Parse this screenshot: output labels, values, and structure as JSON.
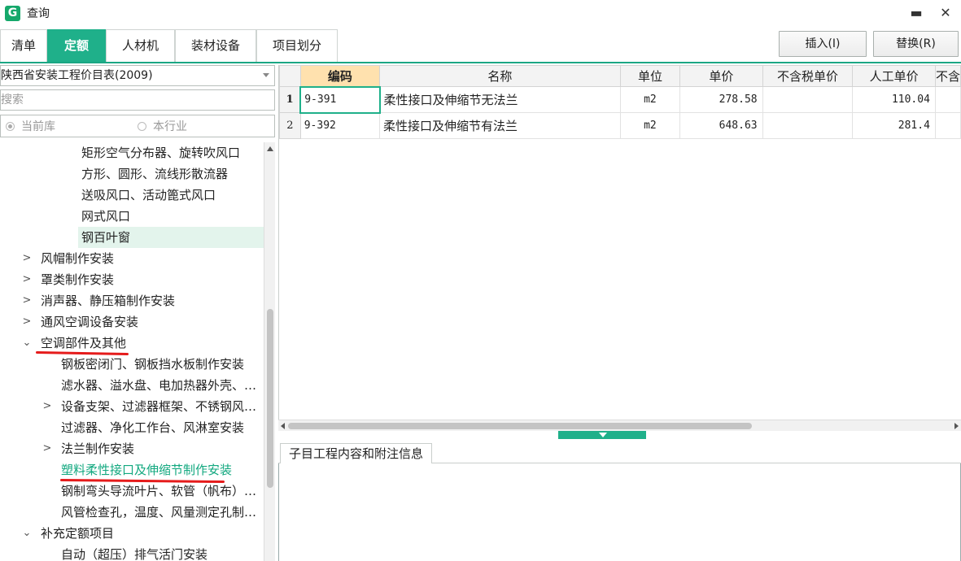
{
  "window": {
    "logo": "G",
    "title": "查询",
    "minimize_glyph": "▬",
    "close_glyph": "✕"
  },
  "tabs": [
    {
      "label": "清单",
      "active": false
    },
    {
      "label": "定额",
      "active": true
    },
    {
      "label": "人材机",
      "active": false
    },
    {
      "label": "装材设备",
      "active": false
    },
    {
      "label": "项目划分",
      "active": false
    }
  ],
  "actions": {
    "insert_label": "插入(I)",
    "replace_label": "替换(R)"
  },
  "library": {
    "selected": "陕西省安装工程价目表(2009)"
  },
  "search": {
    "placeholder": "搜索"
  },
  "scope": {
    "current_lib": "当前库",
    "this_industry": "本行业"
  },
  "tree": {
    "items": [
      {
        "label": "矩形空气分布器、旋转吹风口"
      },
      {
        "label": "方形、圆形、流线形散流器"
      },
      {
        "label": "送吸风口、活动篦式风口"
      },
      {
        "label": "网式风口"
      },
      {
        "label": "钢百叶窗"
      },
      {
        "label": "风帽制作安装"
      },
      {
        "label": "罩类制作安装"
      },
      {
        "label": "消声器、静压箱制作安装"
      },
      {
        "label": "通风空调设备安装"
      },
      {
        "label": "空调部件及其他"
      },
      {
        "label": "钢板密闭门、钢板挡水板制作安装"
      },
      {
        "label": "滤水器、溢水盘、电加热器外壳、…"
      },
      {
        "label": "设备支架、过滤器框架、不锈钢风…"
      },
      {
        "label": "过滤器、净化工作台、风淋室安装"
      },
      {
        "label": "法兰制作安装"
      },
      {
        "label": "塑料柔性接口及伸缩节制作安装"
      },
      {
        "label": "钢制弯头导流叶片、软管（帆布）…"
      },
      {
        "label": "风管检查孔，温度、风量测定孔制…"
      },
      {
        "label": "补充定额项目"
      },
      {
        "label": "自动（超压）排气活门安装"
      }
    ]
  },
  "grid": {
    "columns": [
      "编码",
      "名称",
      "单位",
      "单价",
      "不含税单价",
      "人工单价",
      "不含"
    ],
    "rows": [
      {
        "num": "1",
        "code": "9-391",
        "name": "柔性接口及伸缩节无法兰",
        "unit": "m2",
        "price": "278.58",
        "price_ex_tax": "",
        "labor_price": "110.04"
      },
      {
        "num": "2",
        "code": "9-392",
        "name": "柔性接口及伸缩节有法兰",
        "unit": "m2",
        "price": "648.63",
        "price_ex_tax": "",
        "labor_price": "281.4"
      }
    ]
  },
  "info": {
    "tab_label": "子目工程内容和附注信息"
  },
  "colors": {
    "accent": "#1fb08a",
    "sorted_header": "#ffe1ae",
    "annotation": "#e51b1b"
  }
}
